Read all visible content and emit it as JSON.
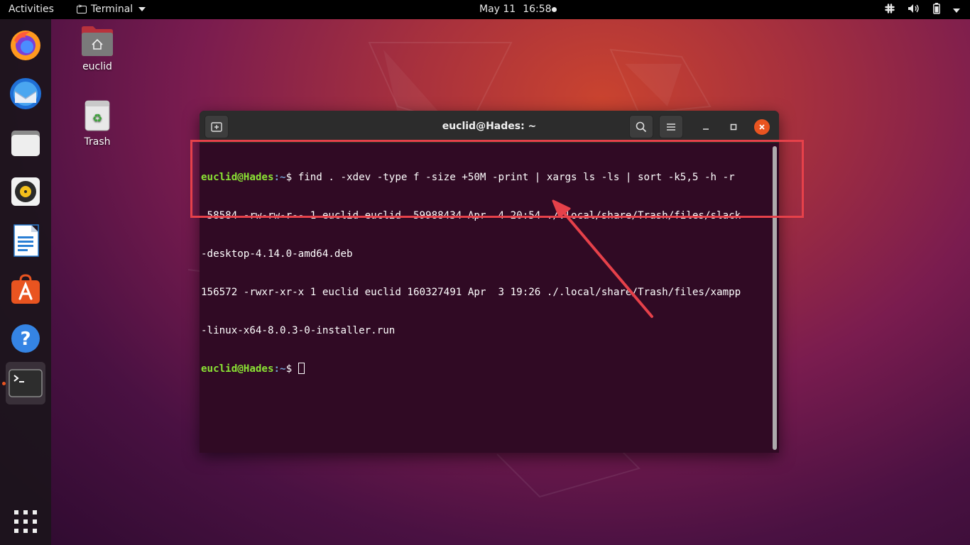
{
  "topbar": {
    "activities": "Activities",
    "app_menu": "Terminal",
    "date": "May 11",
    "time": "16:58"
  },
  "dock": {
    "items": [
      {
        "name": "firefox-icon"
      },
      {
        "name": "thunderbird-icon"
      },
      {
        "name": "files-icon"
      },
      {
        "name": "rhythmbox-icon"
      },
      {
        "name": "libreoffice-writer-icon"
      },
      {
        "name": "ubuntu-software-icon"
      },
      {
        "name": "help-icon"
      },
      {
        "name": "terminal-icon"
      }
    ],
    "show_apps_icon": "grid-icon"
  },
  "desktop": {
    "icons": [
      {
        "label": "euclid",
        "icon": "home-folder-icon"
      },
      {
        "label": "Trash",
        "icon": "trash-icon"
      }
    ]
  },
  "terminal": {
    "title": "euclid@Hades: ~",
    "prompt_user": "euclid@Hades",
    "prompt_path": ":~",
    "prompt_symbol": "$ ",
    "command": "find . -xdev -type f -size +50M -print | xargs ls -ls | sort -k5,5 -h -r",
    "output": [
      " 58584 -rw-rw-r-- 1 euclid euclid  59988434 Apr  4 20:54 ./.local/share/Trash/files/slack",
      "-desktop-4.14.0-amd64.deb",
      "156572 -rwxr-xr-x 1 euclid euclid 160327491 Apr  3 19:26 ./.local/share/Trash/files/xampp",
      "-linux-x64-8.0.3-0-installer.run"
    ],
    "prompt2_user": "euclid@Hades",
    "prompt2_path": ":~",
    "prompt2_symbol": "$ "
  },
  "colors": {
    "accent": "#e95420",
    "annotation": "#e6414a",
    "terminal_bg": "#300a24",
    "prompt_user": "#8ae234",
    "prompt_path": "#729fcf"
  }
}
